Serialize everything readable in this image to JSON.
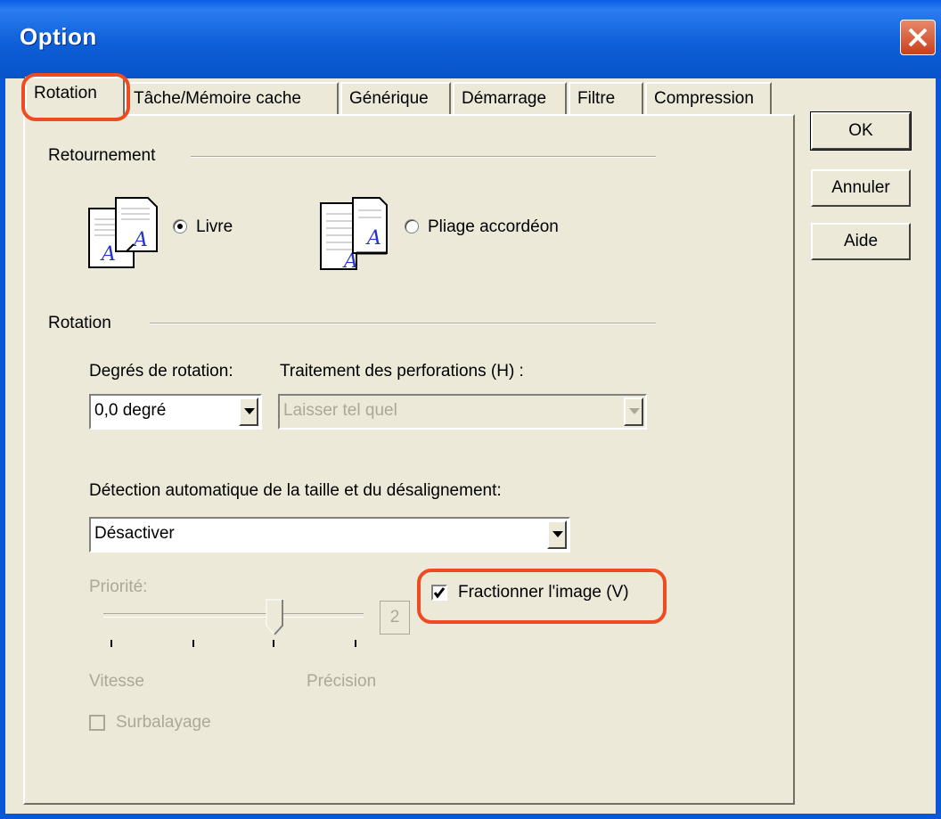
{
  "window": {
    "title": "Option"
  },
  "tabs": [
    "Rotation",
    "Tâche/Mémoire cache",
    "Générique",
    "Démarrage",
    "Filtre",
    "Compression"
  ],
  "buttons": {
    "ok": "OK",
    "cancel": "Annuler",
    "help": "Aide"
  },
  "retournement": {
    "group_label": "Retournement",
    "book_label": "Livre",
    "accordion_label": "Pliage accordéon",
    "selected": "Livre"
  },
  "rotation": {
    "group_label": "Rotation",
    "degrees_label": "Degrés de rotation:",
    "degrees_value": "0,0 degré",
    "punch_label": "Traitement des perforations (H) :",
    "punch_value": "Laisser tel quel",
    "autodetect_label": "Détection automatique de la taille et du désalignement:",
    "autodetect_value": "Désactiver",
    "priority_label": "Priorité:",
    "priority_value": "2",
    "slider_min_label": "Vitesse",
    "slider_max_label": "Précision",
    "split_image_label": "Fractionner l'image (V)",
    "split_image_checked": true,
    "overscan_label": "Surbalayage",
    "overscan_checked": false
  },
  "icons": [
    "close-icon",
    "book-icon",
    "accordion-fold-icon"
  ],
  "colors": {
    "title_bar": "#0a5ee6",
    "highlight": "#ee4b22",
    "face": "#ece9d8",
    "disabled": "#aca899"
  }
}
